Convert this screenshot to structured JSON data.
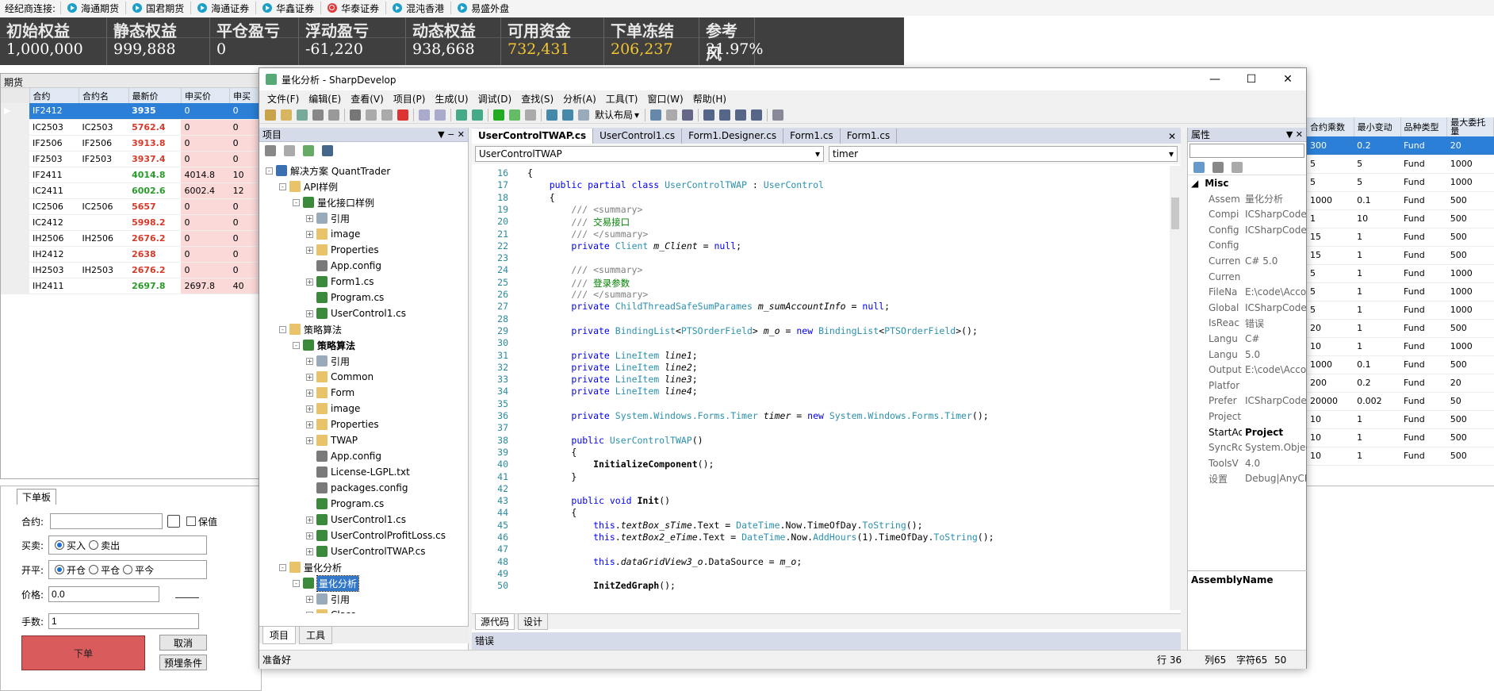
{
  "broker_bar": {
    "label": "经纪商连接:",
    "brokers": [
      {
        "name": "海通期货",
        "icon": "play-icon"
      },
      {
        "name": "国君期货",
        "icon": "play-icon"
      },
      {
        "name": "海通证券",
        "icon": "play-icon"
      },
      {
        "name": "华鑫证券",
        "icon": "play-icon"
      },
      {
        "name": "华泰证券",
        "icon": "power-icon"
      },
      {
        "name": "混沌香港",
        "icon": "play-icon"
      },
      {
        "name": "易盛外盘",
        "icon": "play-icon"
      }
    ]
  },
  "stats": [
    {
      "label": "初始权益",
      "value": "1,000,000"
    },
    {
      "label": "静态权益",
      "value": "999,888"
    },
    {
      "label": "平仓盈亏",
      "value": "0"
    },
    {
      "label": "浮动盈亏",
      "value": "-61,220"
    },
    {
      "label": "动态权益",
      "value": "938,668"
    },
    {
      "label": "可用资金",
      "value": "732,431"
    },
    {
      "label": "下单冻结",
      "value": "206,237"
    },
    {
      "label": "参考风",
      "value": "21.97%"
    }
  ],
  "futures": {
    "title": "期货",
    "columns": [
      "合约",
      "合约名",
      "最新价",
      "申买价",
      "申买"
    ],
    "rows": [
      {
        "code": "IF2412",
        "name": "",
        "last": "3935",
        "bid": "0",
        "bidv": "0",
        "color": "red",
        "selected": true
      },
      {
        "code": "IC2503",
        "name": "IC2503",
        "last": "5762.4",
        "bid": "0",
        "bidv": "0",
        "color": "red"
      },
      {
        "code": "IF2506",
        "name": "IF2506",
        "last": "3913.8",
        "bid": "0",
        "bidv": "0",
        "color": "red"
      },
      {
        "code": "IF2503",
        "name": "IF2503",
        "last": "3937.4",
        "bid": "0",
        "bidv": "0",
        "color": "red"
      },
      {
        "code": "IF2411",
        "name": "",
        "last": "4014.8",
        "bid": "4014.8",
        "bidv": "10",
        "color": "green"
      },
      {
        "code": "IC2411",
        "name": "",
        "last": "6002.6",
        "bid": "6002.4",
        "bidv": "12",
        "color": "green"
      },
      {
        "code": "IC2506",
        "name": "IC2506",
        "last": "5657",
        "bid": "0",
        "bidv": "0",
        "color": "red"
      },
      {
        "code": "IC2412",
        "name": "",
        "last": "5998.2",
        "bid": "0",
        "bidv": "0",
        "color": "red"
      },
      {
        "code": "IH2506",
        "name": "IH2506",
        "last": "2676.2",
        "bid": "0",
        "bidv": "0",
        "color": "red"
      },
      {
        "code": "IH2412",
        "name": "",
        "last": "2638",
        "bid": "0",
        "bidv": "0",
        "color": "red"
      },
      {
        "code": "IH2503",
        "name": "IH2503",
        "last": "2676.2",
        "bid": "0",
        "bidv": "0",
        "color": "red"
      },
      {
        "code": "IH2411",
        "name": "",
        "last": "2697.8",
        "bid": "2697.8",
        "bidv": "40",
        "color": "green"
      }
    ]
  },
  "order_panel": {
    "tab": "下单板",
    "contract_label": "合约:",
    "contract_value": "",
    "hedge_label": "保值",
    "direction_label": "买卖:",
    "buy": "买入",
    "sell": "卖出",
    "offset_label": "开平:",
    "open": "开仓",
    "close": "平仓",
    "close_today": "平今",
    "price_label": "价格:",
    "price_value": "0.0",
    "qty_label": "手数:",
    "qty_value": "1",
    "submit": "下单",
    "cancel": "取消",
    "preset": "预埋条件"
  },
  "right_grid": {
    "columns": [
      "合约乘数",
      "最小变动",
      "品种类型",
      "最大委托量"
    ],
    "rows": [
      [
        "300",
        "0.2",
        "Fund",
        "20"
      ],
      [
        "5",
        "5",
        "Fund",
        "1000"
      ],
      [
        "5",
        "5",
        "Fund",
        "1000"
      ],
      [
        "1000",
        "0.1",
        "Fund",
        "500"
      ],
      [
        "1",
        "10",
        "Fund",
        "500"
      ],
      [
        "15",
        "1",
        "Fund",
        "500"
      ],
      [
        "15",
        "1",
        "Fund",
        "500"
      ],
      [
        "5",
        "1",
        "Fund",
        "1000"
      ],
      [
        "5",
        "1",
        "Fund",
        "1000"
      ],
      [
        "5",
        "1",
        "Fund",
        "1000"
      ],
      [
        "20",
        "1",
        "Fund",
        "500"
      ],
      [
        "10",
        "1",
        "Fund",
        "1000"
      ],
      [
        "1000",
        "0.1",
        "Fund",
        "500"
      ],
      [
        "200",
        "0.2",
        "Fund",
        "20"
      ],
      [
        "20000",
        "0.002",
        "Fund",
        "50"
      ],
      [
        "10",
        "1",
        "Fund",
        "500"
      ],
      [
        "10",
        "1",
        "Fund",
        "500"
      ],
      [
        "10",
        "1",
        "Fund",
        "500"
      ]
    ]
  },
  "ide": {
    "title": "量化分析 - SharpDevelop",
    "menu": [
      "文件(F)",
      "编辑(E)",
      "查看(V)",
      "项目(P)",
      "生成(U)",
      "调试(D)",
      "查找(S)",
      "分析(A)",
      "工具(T)",
      "窗口(W)",
      "帮助(H)"
    ],
    "layout_combo": "默认布局",
    "project_pane": {
      "title": "项目",
      "tabs": [
        "项目",
        "工具"
      ],
      "tree": [
        {
          "label": "解决方案 QuantTrader",
          "depth": 0,
          "icon": "solution",
          "exp": "-"
        },
        {
          "label": "API样例",
          "depth": 1,
          "icon": "folder",
          "exp": "-"
        },
        {
          "label": "量化接口样例",
          "depth": 2,
          "icon": "project",
          "exp": "-"
        },
        {
          "label": "引用",
          "depth": 3,
          "icon": "ref",
          "exp": "+"
        },
        {
          "label": "image",
          "depth": 3,
          "icon": "folder",
          "exp": "+"
        },
        {
          "label": "Properties",
          "depth": 3,
          "icon": "folder",
          "exp": "+"
        },
        {
          "label": "App.config",
          "depth": 3,
          "icon": "cfg",
          "exp": ""
        },
        {
          "label": "Form1.cs",
          "depth": 3,
          "icon": "cs",
          "exp": "+"
        },
        {
          "label": "Program.cs",
          "depth": 3,
          "icon": "cs",
          "exp": ""
        },
        {
          "label": "UserControl1.cs",
          "depth": 3,
          "icon": "cs",
          "exp": "+"
        },
        {
          "label": "策略算法",
          "depth": 1,
          "icon": "folder",
          "exp": "-"
        },
        {
          "label": "策略算法",
          "depth": 2,
          "icon": "project",
          "exp": "-",
          "bold": true
        },
        {
          "label": "引用",
          "depth": 3,
          "icon": "ref",
          "exp": "+"
        },
        {
          "label": "Common",
          "depth": 3,
          "icon": "folder",
          "exp": "+"
        },
        {
          "label": "Form",
          "depth": 3,
          "icon": "folder",
          "exp": "+"
        },
        {
          "label": "image",
          "depth": 3,
          "icon": "folder",
          "exp": "+"
        },
        {
          "label": "Properties",
          "depth": 3,
          "icon": "folder",
          "exp": "+"
        },
        {
          "label": "TWAP",
          "depth": 3,
          "icon": "folder",
          "exp": "+"
        },
        {
          "label": "App.config",
          "depth": 3,
          "icon": "cfg",
          "exp": ""
        },
        {
          "label": "License-LGPL.txt",
          "depth": 3,
          "icon": "cfg",
          "exp": ""
        },
        {
          "label": "packages.config",
          "depth": 3,
          "icon": "cfg",
          "exp": ""
        },
        {
          "label": "Program.cs",
          "depth": 3,
          "icon": "cs",
          "exp": ""
        },
        {
          "label": "UserControl1.cs",
          "depth": 3,
          "icon": "cs",
          "exp": "+"
        },
        {
          "label": "UserControlProfitLoss.cs",
          "depth": 3,
          "icon": "cs",
          "exp": "+"
        },
        {
          "label": "UserControlTWAP.cs",
          "depth": 3,
          "icon": "cs",
          "exp": "+"
        },
        {
          "label": "量化分析",
          "depth": 1,
          "icon": "folder",
          "exp": "-"
        },
        {
          "label": "量化分析",
          "depth": 2,
          "icon": "project",
          "exp": "-",
          "selected": true
        },
        {
          "label": "引用",
          "depth": 3,
          "icon": "ref",
          "exp": "+"
        },
        {
          "label": "Class",
          "depth": 3,
          "icon": "folder",
          "exp": "+"
        }
      ]
    },
    "doc_tabs": [
      "UserControlTWAP.cs",
      "UserControl1.cs",
      "Form1.Designer.cs",
      "Form1.cs",
      "Form1.cs"
    ],
    "class_combo": "UserControlTWAP",
    "member_combo": "timer",
    "code_lines": [
      {
        "n": "16",
        "html": "{"
      },
      {
        "n": "17",
        "html": "    <span class='kw'>public partial class</span> <span class='ty'>UserControlTWAP</span> : <span class='ty'>UserControl</span>"
      },
      {
        "n": "18",
        "html": "    {"
      },
      {
        "n": "19",
        "html": "        <span class='cm'>/// &lt;summary&gt;</span>"
      },
      {
        "n": "20",
        "html": "        <span class='cm'>/// </span><span class='cc'>交易接口</span>"
      },
      {
        "n": "21",
        "html": "        <span class='cm'>/// &lt;/summary&gt;</span>"
      },
      {
        "n": "22",
        "html": "        <span class='kw'>private</span> <span class='ty'>Client</span> <span class='it'>m_Client</span> = <span class='kw'>null</span>;"
      },
      {
        "n": "23",
        "html": ""
      },
      {
        "n": "24",
        "html": "        <span class='cm'>/// &lt;summary&gt;</span>"
      },
      {
        "n": "25",
        "html": "        <span class='cm'>/// </span><span class='cc'>登录参数</span>"
      },
      {
        "n": "26",
        "html": "        <span class='cm'>/// &lt;/summary&gt;</span>"
      },
      {
        "n": "27",
        "html": "        <span class='kw'>private</span> <span class='ty'>ChildThreadSafeSumParames</span> <span class='it'>m_sumAccountInfo</span> = <span class='kw'>null</span>;"
      },
      {
        "n": "28",
        "html": ""
      },
      {
        "n": "29",
        "html": "        <span class='kw'>private</span> <span class='ty'>BindingList</span>&lt;<span class='ty'>PTSOrderField</span>&gt; <span class='it'>m_o</span> = <span class='kw'>new</span> <span class='ty'>BindingList</span>&lt;<span class='ty'>PTSOrderField</span>&gt;();"
      },
      {
        "n": "30",
        "html": ""
      },
      {
        "n": "31",
        "html": "        <span class='kw'>private</span> <span class='ty'>LineItem</span> <span class='it'>line1</span>;"
      },
      {
        "n": "32",
        "html": "        <span class='kw'>private</span> <span class='ty'>LineItem</span> <span class='it'>line2</span>;"
      },
      {
        "n": "33",
        "html": "        <span class='kw'>private</span> <span class='ty'>LineItem</span> <span class='it'>line3</span>;"
      },
      {
        "n": "34",
        "html": "        <span class='kw'>private</span> <span class='ty'>LineItem</span> <span class='it'>line4</span>;"
      },
      {
        "n": "35",
        "html": ""
      },
      {
        "n": "36",
        "html": "        <span class='kw'>private</span> <span class='ty'>System.Windows.Forms.Timer</span> <span class='it'>timer</span> = <span class='kw'>new</span> <span class='ty'>System.Windows.Forms.Timer</span>();"
      },
      {
        "n": "37",
        "html": ""
      },
      {
        "n": "38",
        "html": "        <span class='kw'>public</span> <span class='ty'>UserControlTWAP</span>()"
      },
      {
        "n": "39",
        "html": "        {"
      },
      {
        "n": "40",
        "html": "            <span class='bold'>InitializeComponent</span>();"
      },
      {
        "n": "41",
        "html": "        }"
      },
      {
        "n": "42",
        "html": ""
      },
      {
        "n": "43",
        "html": "        <span class='kw'>public void</span> <span class='bold'>Init</span>()"
      },
      {
        "n": "44",
        "html": "        {"
      },
      {
        "n": "45",
        "html": "            <span class='kw'>this</span>.<span class='it'>textBox_sTime</span>.Text = <span class='ty'>DateTime</span>.Now.TimeOfDay.<span class='ty'>ToString</span>();"
      },
      {
        "n": "46",
        "html": "            <span class='kw'>this</span>.<span class='it'>textBox2_eTime</span>.Text = <span class='ty'>DateTime</span>.Now.<span class='ty'>AddHours</span>(1).TimeOfDay.<span class='ty'>ToString</span>();"
      },
      {
        "n": "47",
        "html": ""
      },
      {
        "n": "48",
        "html": "            <span class='kw'>this</span>.<span class='it'>dataGridView3_o</span>.DataSource = <span class='it'>m_o</span>;"
      },
      {
        "n": "49",
        "html": ""
      },
      {
        "n": "50",
        "html": "            <span class='bold'>InitZedGraph</span>();"
      }
    ],
    "editor_tabs": [
      "源代码",
      "设计"
    ],
    "properties": {
      "title": "属性",
      "category": "Misc",
      "rows": [
        [
          "Assem",
          "量化分析"
        ],
        [
          "Compi",
          "ICSharpCode"
        ],
        [
          "Config",
          "ICSharpCode"
        ],
        [
          "Config",
          ""
        ],
        [
          "Curren",
          "C# 5.0"
        ],
        [
          "Curren",
          ""
        ],
        [
          "FileNa",
          "E:\\code\\Acco"
        ],
        [
          "Global",
          "ICSharpCode"
        ],
        [
          "IsReac",
          "错误"
        ],
        [
          "Langu",
          "C#"
        ],
        [
          "Langu",
          "5.0"
        ],
        [
          "Output",
          "E:\\code\\Acco"
        ],
        [
          "Platfor",
          ""
        ],
        [
          "Prefer",
          "ICSharpCode"
        ],
        [
          "Project",
          ""
        ],
        [
          "StartAc",
          "Project"
        ],
        [
          "SyncRc",
          "System.Object"
        ],
        [
          "ToolsV",
          "4.0"
        ],
        [
          "设置",
          "Debug|AnyCP"
        ]
      ],
      "description_title": "AssemblyName"
    },
    "error_pane_title": "错误",
    "status": {
      "left": "准备好",
      "line": "行 36",
      "col": "列65",
      "char": "字符65",
      "num": "50"
    }
  }
}
